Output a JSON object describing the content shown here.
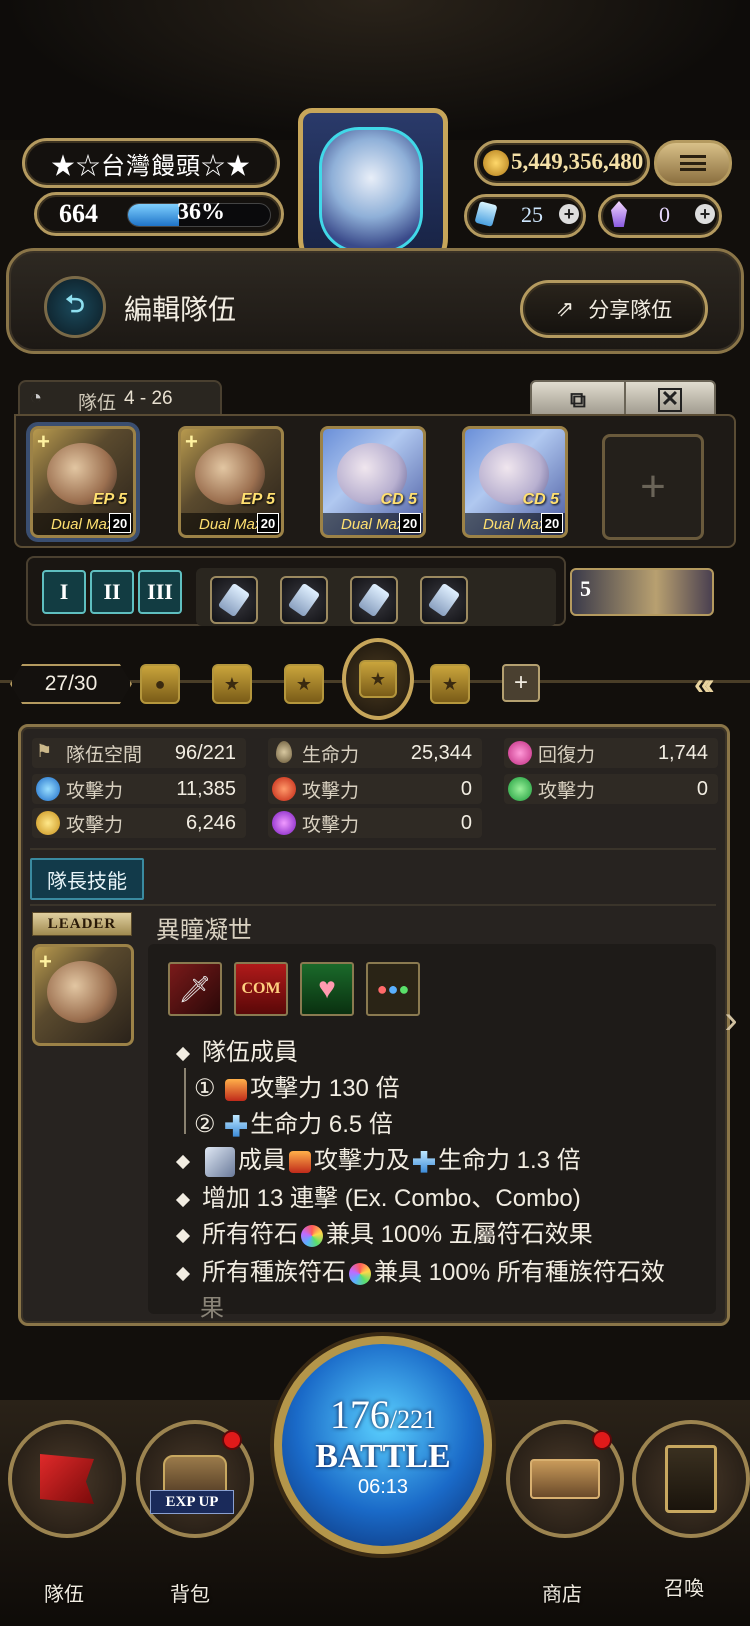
{
  "header": {
    "player_name": "★☆台灣饅頭☆★",
    "level": "664",
    "exp_percent_label": "36%",
    "exp_fraction": 0.36,
    "coins": "5,449,356,480",
    "diamonds": "25",
    "crystals": "0"
  },
  "title_bar": {
    "title": "編輯隊伍",
    "share_label": "分享隊伍"
  },
  "team": {
    "label": "隊伍",
    "number": "4 - 26",
    "cards": [
      {
        "badge": "EP 5",
        "dual": "Dual Max",
        "level": "20",
        "style": "gold"
      },
      {
        "badge": "EP 5",
        "dual": "Dual Max",
        "level": "20",
        "style": "gold"
      },
      {
        "badge": "CD 5",
        "dual": "Dual Max",
        "level": "20",
        "style": "blue"
      },
      {
        "badge": "CD 5",
        "dual": "Dual Max",
        "level": "20",
        "style": "blue"
      }
    ],
    "roman_tabs": [
      "I",
      "II",
      "III"
    ],
    "craft_slot_count": 4,
    "helper_number": "5"
  },
  "pager": {
    "current": "27/30"
  },
  "stats": {
    "space_label": "隊伍空間",
    "space_value": "96/221",
    "hp_label": "生命力",
    "hp_value": "25,344",
    "recover_label": "回復力",
    "recover_value": "1,744",
    "water_atk_label": "攻擊力",
    "water_atk_value": "11,385",
    "fire_atk_label": "攻擊力",
    "fire_atk_value": "0",
    "wood_atk_label": "攻擊力",
    "wood_atk_value": "0",
    "light_atk_label": "攻擊力",
    "light_atk_value": "6,246",
    "dark_atk_label": "攻擊力",
    "dark_atk_value": "0"
  },
  "leader": {
    "tab_label": "隊長技能",
    "badge": "LEADER",
    "skill_name": "異瞳凝世",
    "icon_text": "COM",
    "lines": [
      "隊伍成員",
      "① ",
      "攻擊力 130 倍",
      "② ",
      "生命力 6.5 倍",
      "成員",
      "攻擊力及",
      "生命力 1.3 倍",
      "增加 13 連擊 (Ex. Combo、Combo)",
      "所有符石",
      "兼具 100% 五屬符石效果",
      "所有種族符石",
      "兼具 100% 所有種族符石效",
      "果"
    ]
  },
  "battle": {
    "stamina": "176",
    "stamina_max": "/221",
    "label": "BATTLE",
    "timer": "06:13"
  },
  "bottom_nav": {
    "team": "隊伍",
    "bag": "背包",
    "exp_up": "EXP UP",
    "shop": "商店",
    "summon": "召喚"
  }
}
